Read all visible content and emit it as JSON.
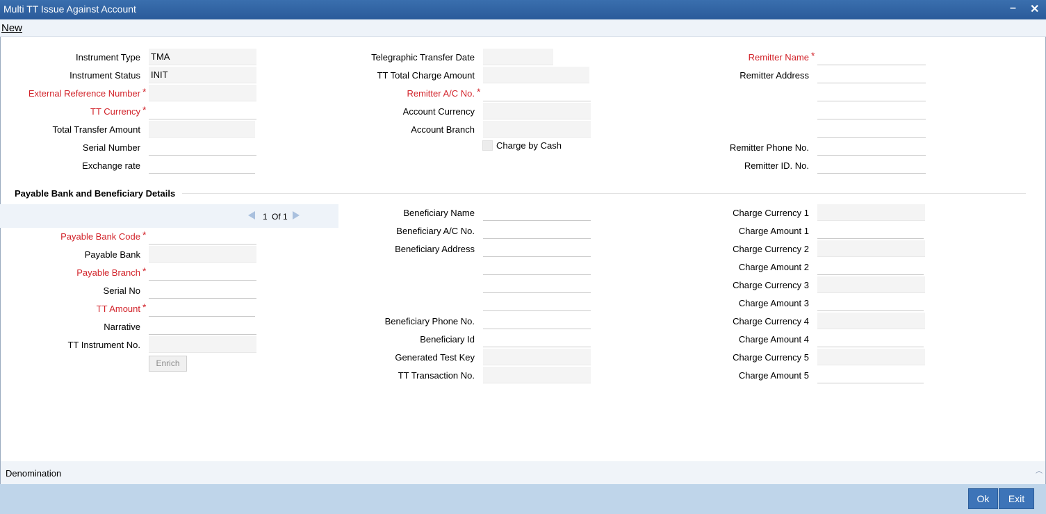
{
  "window": {
    "title": "Multi TT Issue Against Account",
    "minimize": "–",
    "close": "✕"
  },
  "menu": {
    "new": "New"
  },
  "top": {
    "instrument_type": {
      "label": "Instrument Type",
      "value": "TMA"
    },
    "instrument_status": {
      "label": "Instrument Status",
      "value": "INIT"
    },
    "external_reference": {
      "label": "External Reference Number",
      "value": ""
    },
    "tt_currency": {
      "label": "TT Currency",
      "value": ""
    },
    "total_transfer_amount": {
      "label": "Total Transfer Amount",
      "value": ""
    },
    "serial_number": {
      "label": "Serial Number",
      "value": ""
    },
    "exchange_rate": {
      "label": "Exchange rate",
      "value": ""
    },
    "telegraphic_transfer_date": {
      "label": "Telegraphic Transfer Date",
      "value": ""
    },
    "tt_total_charge_amount": {
      "label": "TT Total Charge Amount",
      "value": ""
    },
    "remitter_ac_no": {
      "label": "Remitter A/C No.",
      "value": ""
    },
    "account_currency": {
      "label": "Account Currency",
      "value": ""
    },
    "account_branch": {
      "label": "Account Branch",
      "value": ""
    },
    "charge_by_cash": {
      "label": "Charge by Cash"
    },
    "remitter_name": {
      "label": "Remitter Name",
      "value": ""
    },
    "remitter_address": {
      "label": "Remitter Address"
    },
    "remitter_phone": {
      "label": "Remitter Phone No.",
      "value": ""
    },
    "remitter_id": {
      "label": "Remitter ID. No.",
      "value": ""
    }
  },
  "section": {
    "title": "Payable Bank and Beneficiary Details",
    "nav": {
      "current": "1",
      "of_label": "Of 1"
    },
    "payable_bank_code": {
      "label": "Payable Bank Code"
    },
    "payable_bank": {
      "label": "Payable Bank"
    },
    "payable_branch": {
      "label": "Payable Branch"
    },
    "serial_no": {
      "label": "Serial No"
    },
    "tt_amount": {
      "label": "TT Amount"
    },
    "narrative": {
      "label": "Narrative"
    },
    "tt_instrument_no": {
      "label": "TT Instrument No."
    },
    "enrich": "Enrich",
    "beneficiary_name": {
      "label": "Beneficiary Name"
    },
    "beneficiary_ac_no": {
      "label": "Beneficiary A/C No."
    },
    "beneficiary_address": {
      "label": "Beneficiary Address"
    },
    "beneficiary_phone": {
      "label": "Beneficiary Phone No."
    },
    "beneficiary_id": {
      "label": "Beneficiary Id"
    },
    "generated_test_key": {
      "label": "Generated Test Key"
    },
    "tt_transaction_no": {
      "label": "TT Transaction No."
    },
    "charges": [
      {
        "label": "Charge Currency 1"
      },
      {
        "label": "Charge Amount 1"
      },
      {
        "label": "Charge Currency 2"
      },
      {
        "label": "Charge Amount 2"
      },
      {
        "label": "Charge Currency 3"
      },
      {
        "label": "Charge Amount 3"
      },
      {
        "label": "Charge Currency 4"
      },
      {
        "label": "Charge Amount 4"
      },
      {
        "label": "Charge Currency 5"
      },
      {
        "label": "Charge Amount 5"
      }
    ]
  },
  "denomination": {
    "label": "Denomination"
  },
  "footer": {
    "ok": "Ok",
    "exit": "Exit"
  },
  "colors": {
    "title_bar": "#2f63a3",
    "required": "#d2232a",
    "footer": "#bfd5ea",
    "button": "#3d74b8"
  }
}
